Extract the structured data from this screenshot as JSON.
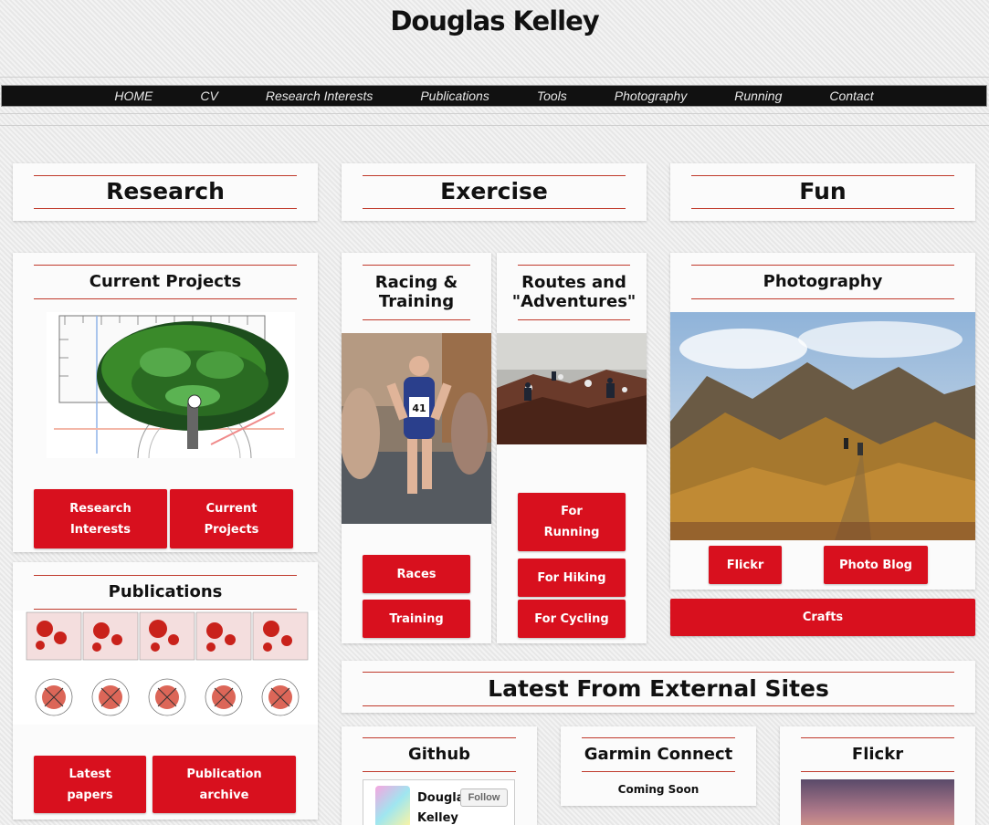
{
  "site": {
    "title": "Douglas Kelley"
  },
  "nav": [
    "HOME",
    "CV",
    "Research Interests",
    "Publications",
    "Tools",
    "Photography",
    "Running",
    "Contact"
  ],
  "sections": {
    "research": "Research",
    "exercise": "Exercise",
    "fun": "Fun"
  },
  "current_projects": {
    "title": "Current Projects",
    "btn_research": "Research Interests",
    "btn_current": "Current Projects"
  },
  "publications": {
    "title": "Publications",
    "btn_latest": "Latest papers",
    "btn_archive": "Publication archive"
  },
  "racing": {
    "title": "Racing & Training",
    "bib": "41",
    "btn_races": "Races",
    "btn_training": "Training"
  },
  "routes": {
    "title": "Routes and \"Adventures\"",
    "btn_running": "For Running",
    "btn_hiking": "For Hiking",
    "btn_cycling": "For Cycling"
  },
  "photography": {
    "title": "Photography",
    "btn_flickr": "Flickr",
    "btn_blog": "Photo Blog",
    "btn_crafts": "Crafts"
  },
  "external": {
    "title": "Latest From External Sites"
  },
  "github": {
    "title": "Github",
    "user_first": "Douglas",
    "user_last": "Kelley",
    "follow": "Follow"
  },
  "garmin": {
    "title": "Garmin Connect",
    "status": "Coming Soon"
  },
  "flickr": {
    "title": "Flickr"
  }
}
